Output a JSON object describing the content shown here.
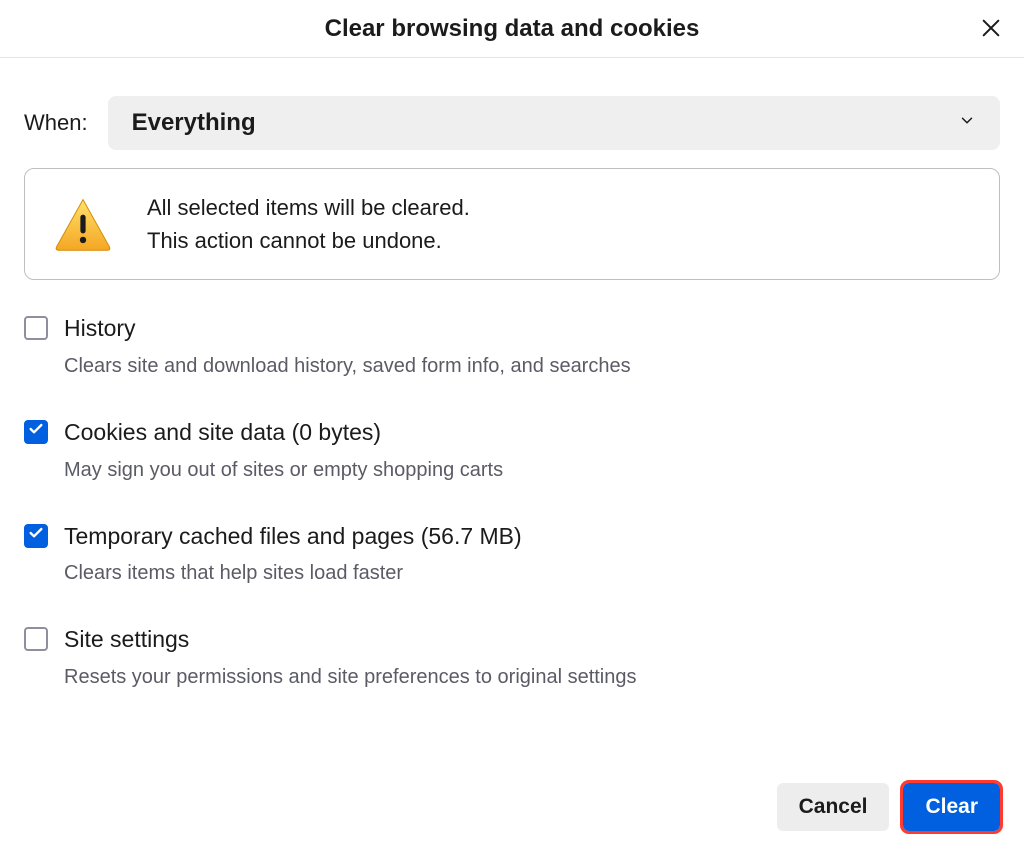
{
  "title": "Clear browsing data and cookies",
  "when": {
    "label": "When:",
    "value": "Everything"
  },
  "warning": {
    "line1": "All selected items will be cleared.",
    "line2": "This action cannot be undone."
  },
  "options": [
    {
      "id": "history",
      "checked": false,
      "label": "History",
      "desc": "Clears site and download history, saved form info, and searches"
    },
    {
      "id": "cookies",
      "checked": true,
      "label": "Cookies and site data (0 bytes)",
      "desc": "May sign you out of sites or empty shopping carts"
    },
    {
      "id": "cache",
      "checked": true,
      "label": "Temporary cached files and pages (56.7 MB)",
      "desc": "Clears items that help sites load faster"
    },
    {
      "id": "site-settings",
      "checked": false,
      "label": "Site settings",
      "desc": "Resets your permissions and site preferences to original settings"
    }
  ],
  "buttons": {
    "cancel": "Cancel",
    "clear": "Clear"
  }
}
